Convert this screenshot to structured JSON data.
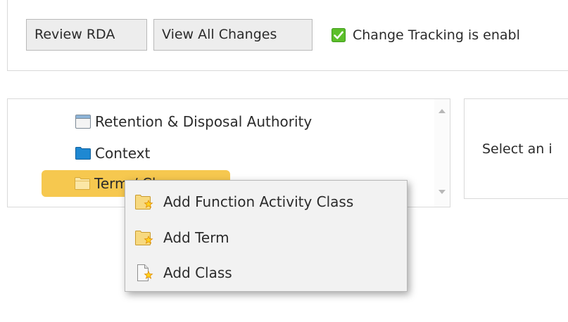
{
  "toolbar": {
    "review_label": "Review RDA",
    "view_changes_label": "View All Changes",
    "tracking_text": "Change Tracking is enabl",
    "tracking_icon": "green-checkbox-icon"
  },
  "tree": {
    "nodes": [
      {
        "label": "Retention & Disposal Authority",
        "icon": "window-icon"
      },
      {
        "label": "Context",
        "icon": "blue-folder-icon"
      },
      {
        "label": "Term / Cl",
        "icon": "folder-icon",
        "selected": true
      }
    ]
  },
  "detail": {
    "text": "Select an i"
  },
  "context_menu": {
    "items": [
      {
        "label": "Add Function Activity Class",
        "icon": "add-folder-icon"
      },
      {
        "label": "Add Term",
        "icon": "add-folder-icon"
      },
      {
        "label": "Add Class",
        "icon": "add-document-icon"
      }
    ]
  },
  "colors": {
    "selection": "#f6c84f",
    "check": "#5cbf2a",
    "folder_blue": "#1e88d2"
  }
}
